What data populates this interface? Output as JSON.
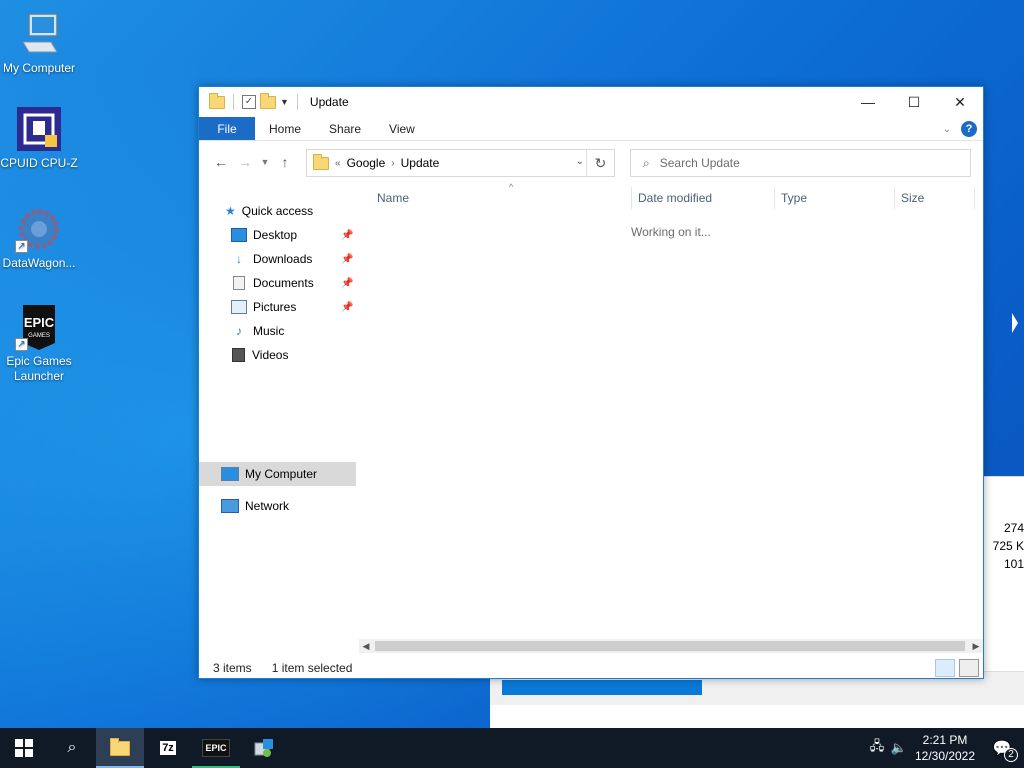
{
  "desktop": {
    "icons": [
      {
        "label": "My Computer"
      },
      {
        "label": "CPUID CPU-Z"
      },
      {
        "label": "DataWagon..."
      },
      {
        "label": "Epic Games Launcher"
      }
    ],
    "epic_text": "EPIC",
    "epic_subtext": "GAMES"
  },
  "background_window": {
    "values": [
      "274",
      "725 K",
      "101"
    ]
  },
  "explorer": {
    "title": "Update",
    "tabs": [
      "File",
      "Home",
      "Share",
      "View"
    ],
    "help_label": "?",
    "address": {
      "overflow": "«",
      "crumbs": [
        "Google",
        "Update"
      ]
    },
    "search_placeholder": "Search Update",
    "nav_pane": {
      "quick_access": "Quick access",
      "items": [
        "Desktop",
        "Downloads",
        "Documents",
        "Pictures",
        "Music",
        "Videos"
      ],
      "my_computer": "My Computer",
      "network": "Network"
    },
    "columns": [
      "Name",
      "Date modified",
      "Type",
      "Size"
    ],
    "loading_text": "Working on it...",
    "status": {
      "items": "3 items",
      "selected": "1 item selected"
    }
  },
  "taskbar": {
    "time": "2:21 PM",
    "date": "12/30/2022",
    "notification_count": "2",
    "sevenzip_label": "7z",
    "epic_label": "EPIC"
  },
  "colors": {
    "accent": "#1a6cc7",
    "taskbar": "#101a27",
    "folder": "#f8d775"
  }
}
